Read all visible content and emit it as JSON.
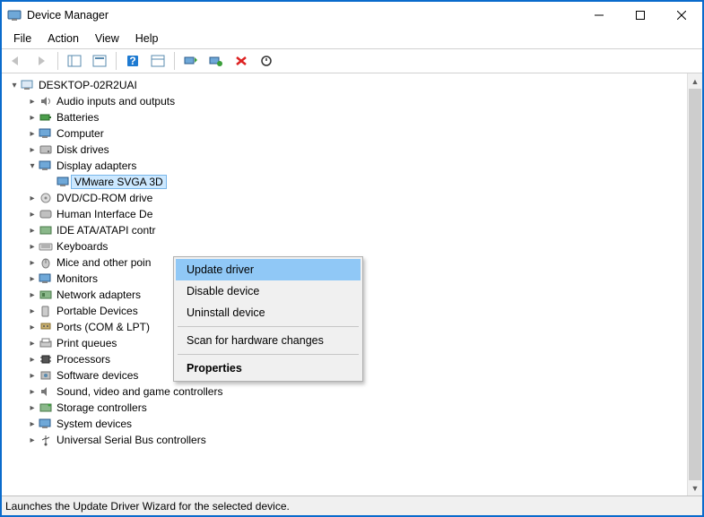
{
  "window": {
    "title": "Device Manager"
  },
  "menu": {
    "file": "File",
    "action": "Action",
    "view": "View",
    "help": "Help"
  },
  "tree": {
    "root": "DESKTOP-02R2UAI",
    "cats": [
      {
        "label": "Audio inputs and outputs"
      },
      {
        "label": "Batteries"
      },
      {
        "label": "Computer"
      },
      {
        "label": "Disk drives"
      },
      {
        "label": "Display adapters",
        "expanded": true,
        "child": "VMware SVGA 3D"
      },
      {
        "label": "DVD/CD-ROM drives"
      },
      {
        "label": "Human Interface Devices"
      },
      {
        "label": "IDE ATA/ATAPI controllers"
      },
      {
        "label": "Keyboards"
      },
      {
        "label": "Mice and other pointing devices"
      },
      {
        "label": "Monitors"
      },
      {
        "label": "Network adapters"
      },
      {
        "label": "Portable Devices"
      },
      {
        "label": "Ports (COM & LPT)"
      },
      {
        "label": "Print queues"
      },
      {
        "label": "Processors"
      },
      {
        "label": "Software devices"
      },
      {
        "label": "Sound, video and game controllers"
      },
      {
        "label": "Storage controllers"
      },
      {
        "label": "System devices"
      },
      {
        "label": "Universal Serial Bus controllers"
      }
    ],
    "trunc": {
      "dvd": "DVD/CD-ROM drive",
      "hid": "Human Interface De",
      "ide": "IDE ATA/ATAPI contr",
      "mice": "Mice and other poin"
    }
  },
  "context": {
    "update": "Update driver",
    "disable": "Disable device",
    "uninstall": "Uninstall device",
    "scan": "Scan for hardware changes",
    "properties": "Properties"
  },
  "status": "Launches the Update Driver Wizard for the selected device."
}
